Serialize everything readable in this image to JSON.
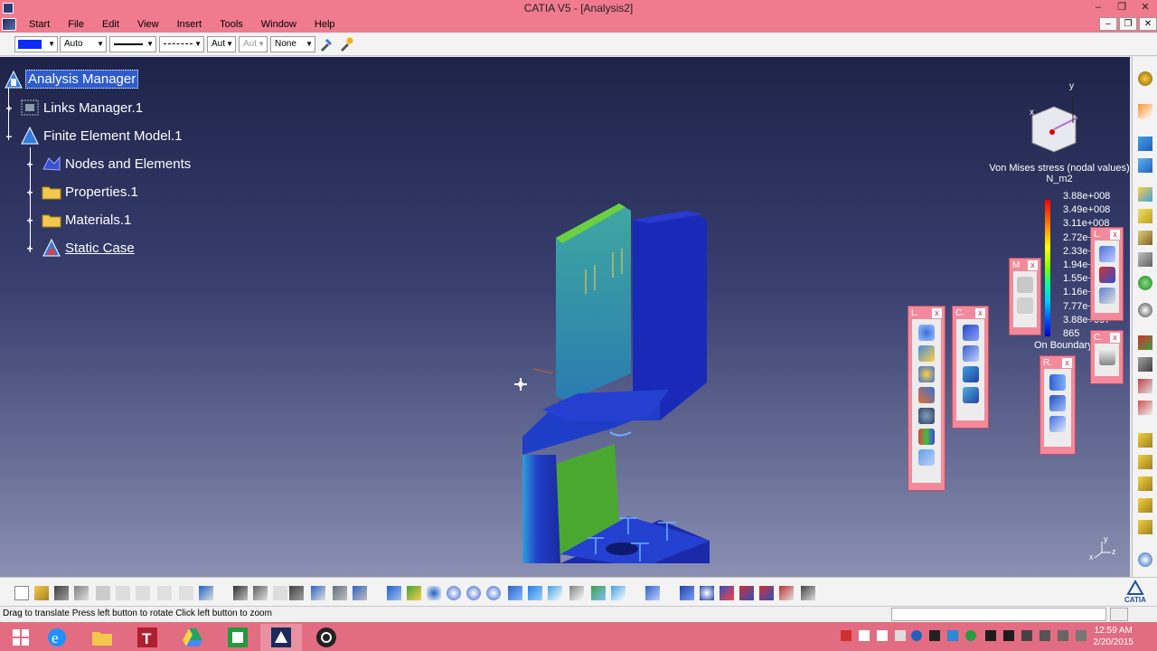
{
  "window": {
    "title": "CATIA V5 - [Analysis2]",
    "minimize": "–",
    "restore": "❐",
    "close": "✕"
  },
  "menu": {
    "items": [
      "Start",
      "File",
      "Edit",
      "View",
      "Insert",
      "Tools",
      "Window",
      "Help"
    ],
    "doc_controls": [
      "–",
      "❐",
      "✕"
    ]
  },
  "properties_toolbar": {
    "line_type": "Auto",
    "thickness": "Aut",
    "point_symbol": "Aut",
    "layer": "None",
    "fill_color": "#0a2cff"
  },
  "spec_tree": {
    "root": "Analysis Manager",
    "links_manager": "Links Manager.1",
    "fem_model": "Finite Element Model.1",
    "nodes_elements": "Nodes and Elements",
    "properties": "Properties.1",
    "materials": "Materials.1",
    "static_case": "Static Case"
  },
  "compass": {
    "x_label": "x",
    "y_label": "y"
  },
  "mini_axis": {
    "x_label": "x",
    "y_label": "y",
    "z_label": "z"
  },
  "legend": {
    "title": "Von Mises stress (nodal values)",
    "unit": "N_m2",
    "values": [
      "3.88e+008",
      "3.49e+008",
      "3.11e+008",
      "2.72e+008",
      "2.33e+008",
      "1.94e+008",
      "1.55e+008",
      "1.16e+008",
      "7.77e+007",
      "3.88e+007",
      "865"
    ],
    "footer": "On Boundary"
  },
  "floating_toolbars": {
    "l1": "L.",
    "c1": "C.",
    "m1": "M",
    "l2": "L.",
    "r1": "R.",
    "c2": "C.",
    "close": "x"
  },
  "status": {
    "message": "Drag to translate  Press left button to rotate  Click left button to zoom"
  },
  "taskbar": {
    "time": "12:59 AM",
    "date": "2/20/2015"
  },
  "colors": {
    "accent_pink": "#f07a8e",
    "selection_blue": "#2e5ccf",
    "part_blue": "#1f2fb8"
  }
}
